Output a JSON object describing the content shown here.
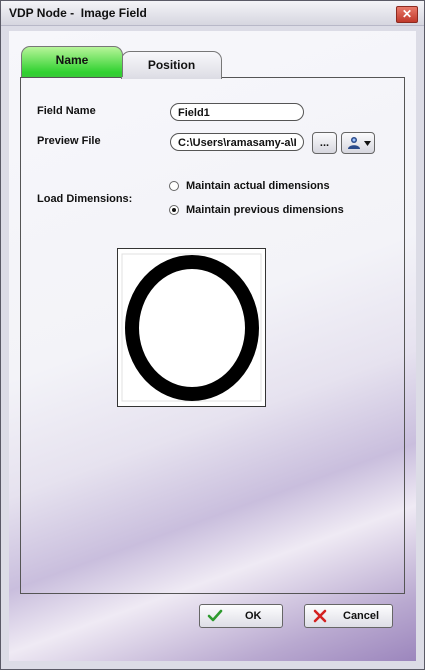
{
  "window": {
    "title": "VDP Node -  Image Field",
    "close_symbol": "✕"
  },
  "tabs": [
    {
      "label": "Name",
      "active": true
    },
    {
      "label": "Position",
      "active": false
    }
  ],
  "form": {
    "field_name_label": "Field Name",
    "field_name_value": "Field1",
    "preview_file_label": "Preview File",
    "preview_file_value": "C:\\Users\\ramasamy-a\\I",
    "browse_label": "...",
    "load_dimensions_label": "Load Dimensions:",
    "radio_options": [
      {
        "label": "Maintain actual dimensions",
        "selected": false
      },
      {
        "label": "Maintain previous dimensions",
        "selected": true
      }
    ]
  },
  "preview": {
    "image": "black-ring-oval"
  },
  "buttons": {
    "ok_label": "OK",
    "cancel_label": "Cancel"
  },
  "icons": {
    "ok": "checkmark-icon",
    "cancel": "x-icon",
    "user_menu": "user-icon"
  },
  "colors": {
    "active_tab": "#2fd12f",
    "ok_check": "#2e9a2e",
    "cancel_x": "#d42020"
  }
}
